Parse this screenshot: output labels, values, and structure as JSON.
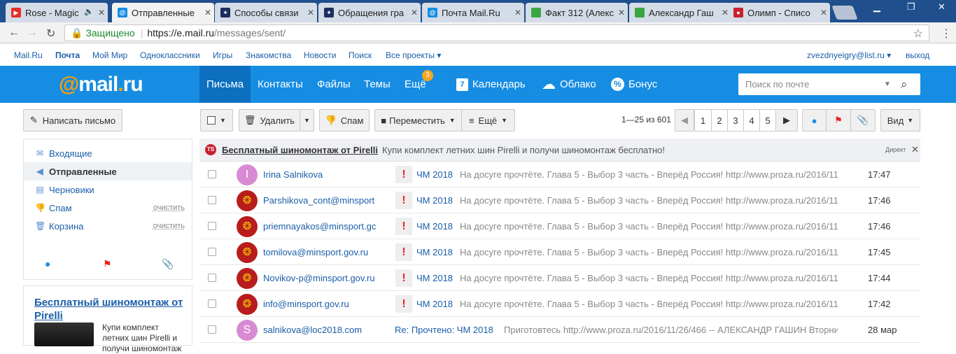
{
  "browser": {
    "tabs": [
      {
        "title": "Rose - Magic",
        "favicon": "youtube-icon",
        "color": "#e52d27",
        "glyph": "▶"
      },
      {
        "title": "Отправленные",
        "favicon": "mailru-icon",
        "color": "#168de2",
        "glyph": "@"
      },
      {
        "title": "Способы связи",
        "favicon": "emblem-icon",
        "color": "#1b2e5e",
        "glyph": "✦"
      },
      {
        "title": "Обращения гра",
        "favicon": "emblem-icon",
        "color": "#1b2e5e",
        "glyph": "✦"
      },
      {
        "title": "Почта Mail.Ru",
        "favicon": "mailru-icon",
        "color": "#168de2",
        "glyph": "@"
      },
      {
        "title": "Факт 312 (Алекс",
        "favicon": "sheet-icon",
        "color": "#3aa63f",
        "glyph": ""
      },
      {
        "title": "Александр Гаш",
        "favicon": "sheet-icon",
        "color": "#3aa63f",
        "glyph": ""
      },
      {
        "title": "Олимп - Списо",
        "favicon": "olymp-icon",
        "color": "#c8202f",
        "glyph": "●"
      }
    ],
    "secure_label": "Защищено",
    "url_host": "https://e.mail.ru",
    "url_path": "/messages/sent/"
  },
  "portal": {
    "links": [
      "Mail.Ru",
      "Почта",
      "Мой Мир",
      "Одноклассники",
      "Игры",
      "Знакомства",
      "Новости",
      "Поиск",
      "Все проекты ▾"
    ],
    "user": "zvezdnyeigry@list.ru ▾",
    "logout": "выход"
  },
  "header": {
    "logo_at": "@",
    "logo_name": "mail",
    "logo_dot": ".",
    "logo_tld": "ru",
    "nav": [
      "Письма",
      "Контакты",
      "Файлы",
      "Темы",
      "Ещё"
    ],
    "more_badge": "3",
    "calendar_label": "Календарь",
    "calendar_day": "7",
    "cloud_label": "Облако",
    "bonus_label": "Бонус",
    "search_placeholder": "Поиск по почте"
  },
  "toolbar": {
    "compose": "Написать письмо",
    "delete": "Удалить",
    "spam": "Спам",
    "move": "Переместить",
    "more": "Ещё",
    "pagination_info": "1—25 из 601",
    "pages": [
      "1",
      "2",
      "3",
      "4",
      "5"
    ],
    "view": "Вид"
  },
  "folders": [
    {
      "label": "Входящие",
      "icon": "inbox-icon",
      "glyph": "✉",
      "clean": ""
    },
    {
      "label": "Отправленные",
      "icon": "sent-icon",
      "glyph": "◀",
      "clean": ""
    },
    {
      "label": "Черновики",
      "icon": "drafts-icon",
      "glyph": "▤",
      "clean": ""
    },
    {
      "label": "Спам",
      "icon": "spam-icon",
      "glyph": "👎",
      "clean": "очистить"
    },
    {
      "label": "Корзина",
      "icon": "trash-icon",
      "glyph": "🗑",
      "clean": "очистить"
    }
  ],
  "ad": {
    "title": "Бесплатный шиномонтаж от Pirelli",
    "text": "Купи комплект летних шин Pirelli и получи шиномонтаж"
  },
  "promo": {
    "badge": "TS",
    "title": "Бесплатный шиномонтаж от Pirelli",
    "text": "Купи комплект летних шин Pirelli и получи шиномонтаж бесплатно!",
    "direct": "Директ"
  },
  "messages": [
    {
      "sender": "Irina Salnikova",
      "avatar": "I",
      "avatar_color": "#d88bd3",
      "flag": true,
      "subject": "ЧМ 2018",
      "snippet": "На досуге прочтёте. Глава 5 - Выбор 3 часть - Вперёд Россия! http://www.proza.ru/2016/11",
      "time": "17:47"
    },
    {
      "sender": "Parshikova_cont@minsport",
      "avatar": "crest",
      "avatar_color": "#b81c1c",
      "flag": true,
      "subject": "ЧМ 2018",
      "snippet": "На досуге прочтёте. Глава 5 - Выбор 3 часть - Вперёд Россия! http://www.proza.ru/2016/11",
      "time": "17:46"
    },
    {
      "sender": "priemnayakos@minsport.gc",
      "avatar": "crest",
      "avatar_color": "#b81c1c",
      "flag": true,
      "subject": "ЧМ 2018",
      "snippet": "На досуге прочтёте. Глава 5 - Выбор 3 часть - Вперёд Россия! http://www.proza.ru/2016/11",
      "time": "17:46"
    },
    {
      "sender": "tomilova@minsport.gov.ru",
      "avatar": "crest",
      "avatar_color": "#b81c1c",
      "flag": true,
      "subject": "ЧМ 2018",
      "snippet": "На досуге прочтёте. Глава 5 - Выбор 3 часть - Вперёд Россия! http://www.proza.ru/2016/11",
      "time": "17:45"
    },
    {
      "sender": "Novikov-p@minsport.gov.ru",
      "avatar": "crest",
      "avatar_color": "#b81c1c",
      "flag": true,
      "subject": "ЧМ 2018",
      "snippet": "На досуге прочтёте. Глава 5 - Выбор 3 часть - Вперёд Россия! http://www.proza.ru/2016/11",
      "time": "17:44"
    },
    {
      "sender": "info@minsport.gov.ru",
      "avatar": "crest",
      "avatar_color": "#b81c1c",
      "flag": true,
      "subject": "ЧМ 2018",
      "snippet": "На досуге прочтёте. Глава 5 - Выбор 3 часть - Вперёд Россия! http://www.proza.ru/2016/11",
      "time": "17:42"
    },
    {
      "sender": "salnikova@loc2018.com",
      "avatar": "S",
      "avatar_color": "#d88bd3",
      "flag": false,
      "subject": "Re: Прочтено: ЧМ 2018",
      "snippet": "Приготовтесь http://www.proza.ru/2016/11/26/466 -- АЛЕКСАНДР ГАШИН Вторни",
      "time": "28 мар"
    }
  ]
}
